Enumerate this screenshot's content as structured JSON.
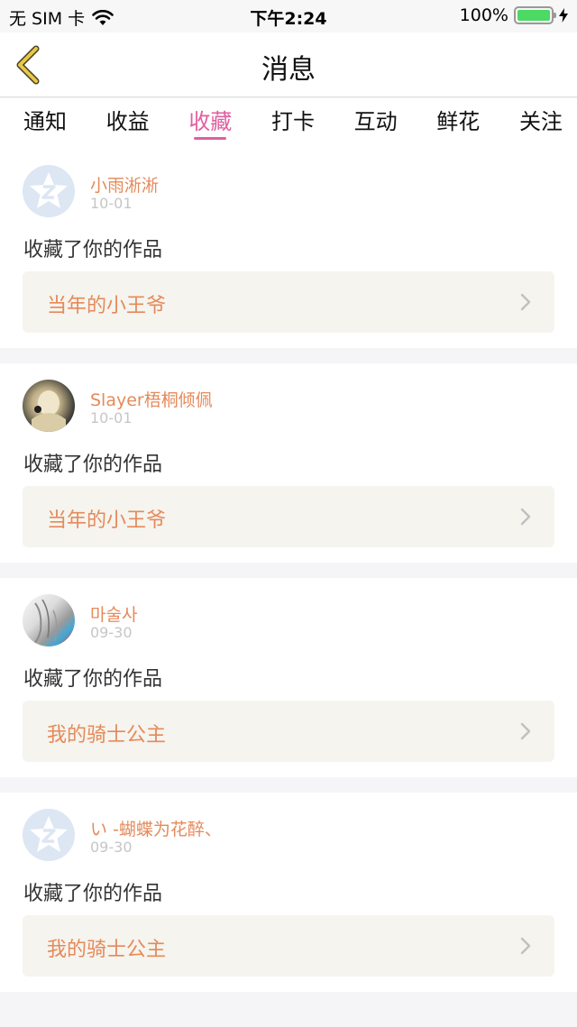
{
  "status_bar": {
    "carrier": "无 SIM 卡",
    "time": "下午2:24",
    "battery_percent": "100%",
    "battery_level": 1.0
  },
  "nav": {
    "title": "消息",
    "back_icon": "chevron-left-icon",
    "accent_color": "#e8c84a"
  },
  "tabs": [
    {
      "label": "通知",
      "active": false
    },
    {
      "label": "收益",
      "active": false
    },
    {
      "label": "收藏",
      "active": true
    },
    {
      "label": "打卡",
      "active": false
    },
    {
      "label": "互动",
      "active": false
    },
    {
      "label": "鲜花",
      "active": false
    },
    {
      "label": "关注",
      "active": false
    }
  ],
  "active_tab_color": "#e05ea0",
  "feed": [
    {
      "name": "小雨淅淅",
      "date": "10-01",
      "action": "收藏了你的作品",
      "work_title": "当年的小王爷",
      "avatar": "qq-default-avatar"
    },
    {
      "name": "Slayer梧桐倾佩",
      "date": "10-01",
      "action": "收藏了你的作品",
      "work_title": "当年的小王爷",
      "avatar": "anime-avatar"
    },
    {
      "name": "마술사",
      "date": "09-30",
      "action": "收藏了你的作品",
      "work_title": "我的骑士公主",
      "avatar": "anime-avatar"
    },
    {
      "name": "い -蝴蝶为花醉、",
      "date": "09-30",
      "action": "收藏了你的作品",
      "work_title": "我的骑士公主",
      "avatar": "qq-default-avatar"
    }
  ]
}
